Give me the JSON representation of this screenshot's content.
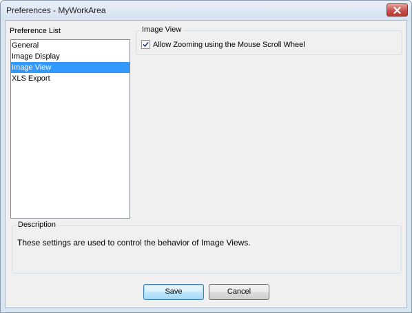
{
  "window": {
    "title": "Preferences - MyWorkArea"
  },
  "preference_list": {
    "label": "Preference List",
    "items": [
      "General",
      "Image Display",
      "Image View",
      "XLS Export"
    ],
    "selected_index": 2
  },
  "image_view": {
    "group_title": "Image View",
    "checkbox_label": "Allow Zooming using the Mouse Scroll Wheel",
    "checked": true
  },
  "description": {
    "group_title": "Description",
    "text": "These settings are used to control the behavior of Image Views."
  },
  "buttons": {
    "save": "Save",
    "cancel": "Cancel"
  },
  "colors": {
    "selection": "#3399ff",
    "close_button": "#c75050"
  },
  "icons": {
    "close": "close-icon",
    "checkmark": "checkmark-icon"
  }
}
